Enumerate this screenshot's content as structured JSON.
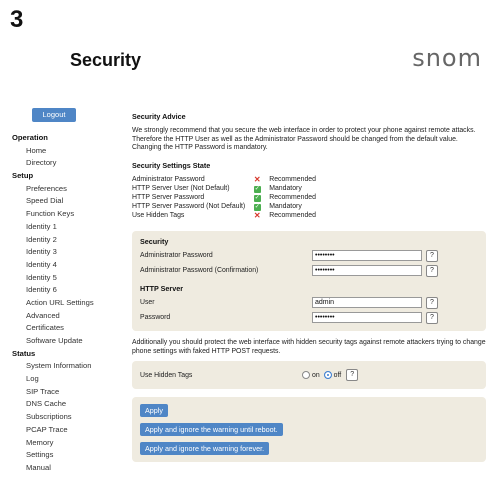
{
  "header": {
    "step_number": "3",
    "title": "Security",
    "brand": "snom"
  },
  "sidebar": {
    "logout_label": "Logout",
    "sections": [
      {
        "label": "Operation",
        "items": [
          "Home",
          "Directory"
        ]
      },
      {
        "label": "Setup",
        "items": [
          "Preferences",
          "Speed Dial",
          "Function Keys",
          "Identity 1",
          "Identity 2",
          "Identity 3",
          "Identity 4",
          "Identity 5",
          "Identity 6",
          "Action URL Settings",
          "Advanced",
          "Certificates",
          "Software Update"
        ]
      },
      {
        "label": "Status",
        "items": [
          "System Information",
          "Log",
          "SIP Trace",
          "DNS Cache",
          "Subscriptions",
          "PCAP Trace",
          "Memory",
          "Settings",
          "Manual"
        ]
      }
    ]
  },
  "advice": {
    "title": "Security Advice",
    "text": "We strongly recommend that you secure the web interface in order to protect your phone against remote attacks. Therefore the HTTP User as well as the Administrator Password should be changed from the default value. Changing the HTTP Password is mandatory."
  },
  "state": {
    "title": "Security Settings State",
    "rows": [
      {
        "name": "Administrator Password",
        "ok": false,
        "level": "Recommended"
      },
      {
        "name": "HTTP Server User (Not Default)",
        "ok": true,
        "level": "Mandatory"
      },
      {
        "name": "HTTP Server Password",
        "ok": true,
        "level": "Recommended"
      },
      {
        "name": "HTTP Server Password (Not Default)",
        "ok": true,
        "level": "Mandatory"
      },
      {
        "name": "Use Hidden Tags",
        "ok": false,
        "level": "Recommended"
      }
    ]
  },
  "security_form": {
    "title": "Security",
    "admin_password_label": "Administrator Password",
    "admin_password_value": "••••••••",
    "admin_password_confirm_label": "Administrator Password (Confirmation)",
    "admin_password_confirm_value": "••••••••",
    "http_title": "HTTP Server",
    "user_label": "User",
    "user_value": "admin",
    "password_label": "Password",
    "password_value": "••••••••",
    "help_label": "?"
  },
  "hidden_tags": {
    "text": "Additionally you should protect the web interface with hidden security tags against remote attackers trying to change phone settings with faked HTTP POST requests.",
    "label": "Use Hidden Tags",
    "on_label": "on",
    "off_label": "off",
    "selected": "off",
    "help_label": "?"
  },
  "actions": {
    "apply": "Apply",
    "apply_until_reboot": "Apply and ignore the warning until reboot.",
    "apply_forever": "Apply and ignore the warning forever."
  },
  "colors": {
    "button": "#4f86c6",
    "panel": "#efebe0",
    "ok": "#4caf50",
    "error": "#d6372b"
  }
}
